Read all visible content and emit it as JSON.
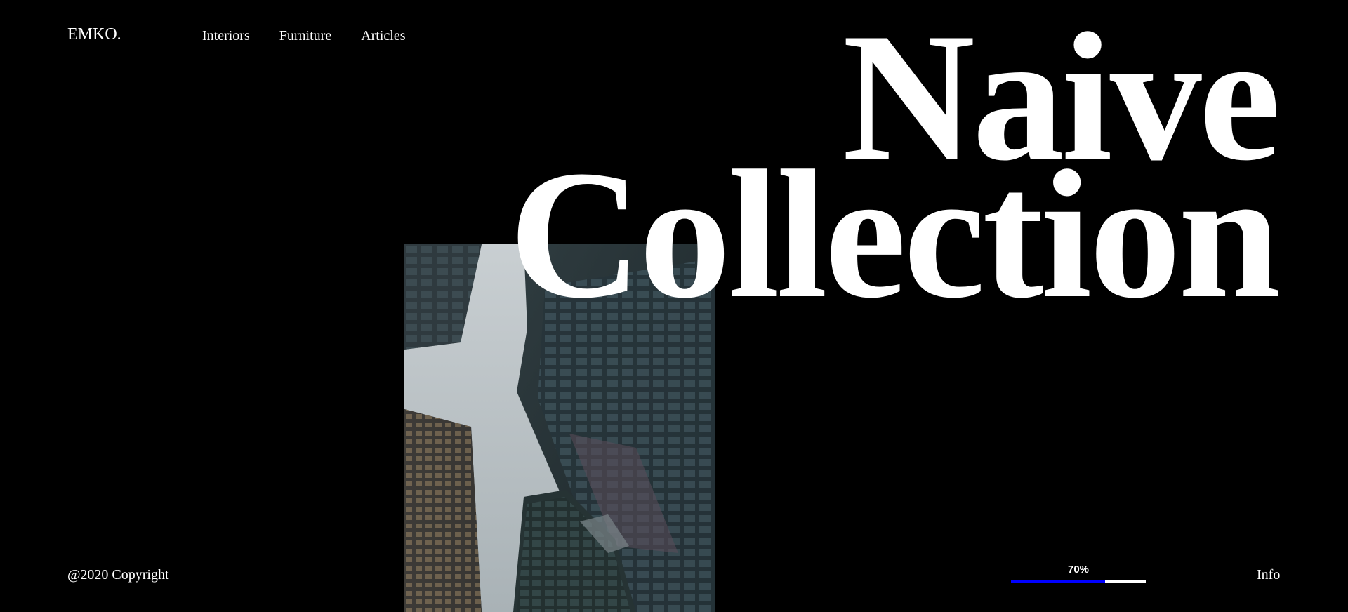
{
  "brand": {
    "logo": "EMKO."
  },
  "nav": {
    "items": [
      {
        "label": "Interiors"
      },
      {
        "label": "Furniture"
      },
      {
        "label": "Articles"
      }
    ]
  },
  "hero": {
    "title_line1": "Naive",
    "title_line2": "Collection",
    "image_icon": "skyscrapers-photo"
  },
  "footer": {
    "copyright": "@2020 Copyright",
    "progress_label": "70%",
    "progress_fraction": 0.7,
    "info_label": "Info"
  },
  "colors": {
    "background": "#000000",
    "text": "#ffffff",
    "progress_fill": "#0000ff",
    "progress_track": "#ffffff"
  }
}
